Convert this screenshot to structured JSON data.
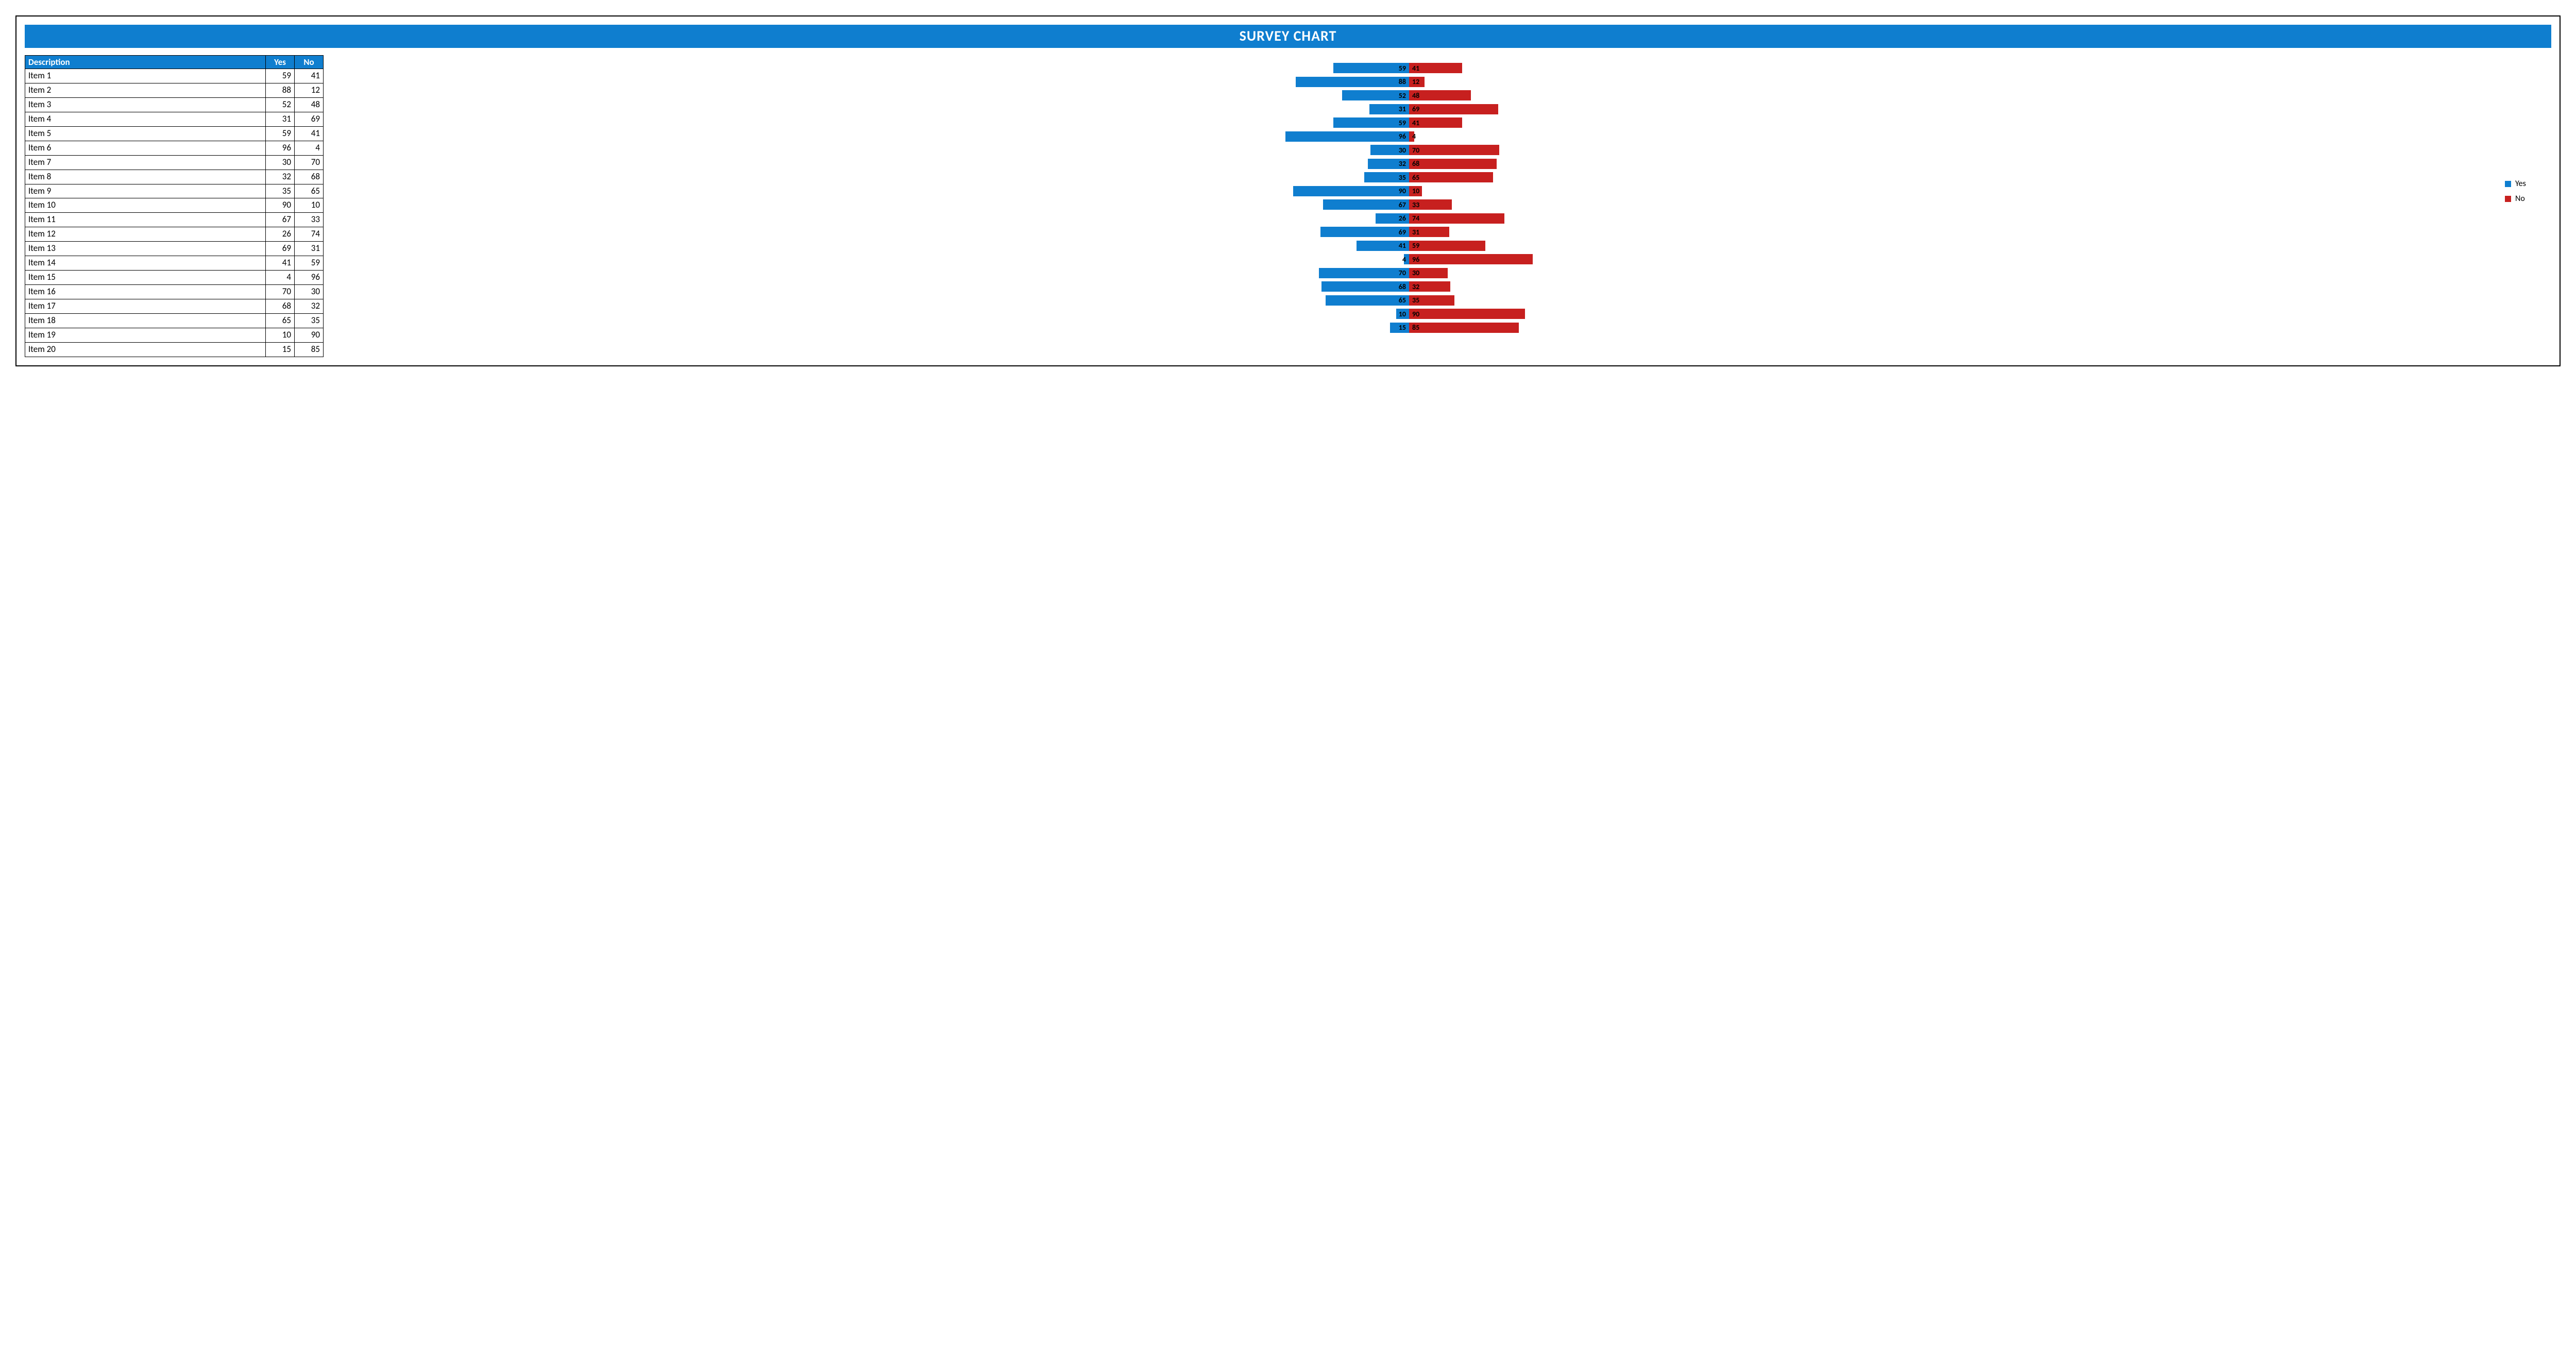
{
  "title": "SURVEY CHART",
  "columns": {
    "desc": "Description",
    "yes": "Yes",
    "no": "No"
  },
  "legend": {
    "yes": "Yes",
    "no": "No"
  },
  "items": [
    {
      "desc": "Item 1",
      "yes": 59,
      "no": 41
    },
    {
      "desc": "Item 2",
      "yes": 88,
      "no": 12
    },
    {
      "desc": "Item 3",
      "yes": 52,
      "no": 48
    },
    {
      "desc": "Item 4",
      "yes": 31,
      "no": 69
    },
    {
      "desc": "Item 5",
      "yes": 59,
      "no": 41
    },
    {
      "desc": "Item 6",
      "yes": 96,
      "no": 4
    },
    {
      "desc": "Item 7",
      "yes": 30,
      "no": 70
    },
    {
      "desc": "Item 8",
      "yes": 32,
      "no": 68
    },
    {
      "desc": "Item 9",
      "yes": 35,
      "no": 65
    },
    {
      "desc": "Item 10",
      "yes": 90,
      "no": 10
    },
    {
      "desc": "Item 11",
      "yes": 67,
      "no": 33
    },
    {
      "desc": "Item 12",
      "yes": 26,
      "no": 74
    },
    {
      "desc": "Item 13",
      "yes": 69,
      "no": 31
    },
    {
      "desc": "Item 14",
      "yes": 41,
      "no": 59
    },
    {
      "desc": "Item 15",
      "yes": 4,
      "no": 96
    },
    {
      "desc": "Item 16",
      "yes": 70,
      "no": 30
    },
    {
      "desc": "Item 17",
      "yes": 68,
      "no": 32
    },
    {
      "desc": "Item 18",
      "yes": 65,
      "no": 35
    },
    {
      "desc": "Item 19",
      "yes": 10,
      "no": 90
    },
    {
      "desc": "Item 20",
      "yes": 15,
      "no": 85
    }
  ],
  "chart_data": {
    "type": "bar",
    "title": "SURVEY CHART",
    "orientation": "horizontal-diverging",
    "categories": [
      "Item 1",
      "Item 2",
      "Item 3",
      "Item 4",
      "Item 5",
      "Item 6",
      "Item 7",
      "Item 8",
      "Item 9",
      "Item 10",
      "Item 11",
      "Item 12",
      "Item 13",
      "Item 14",
      "Item 15",
      "Item 16",
      "Item 17",
      "Item 18",
      "Item 19",
      "Item 20"
    ],
    "series": [
      {
        "name": "Yes",
        "color": "#0f7ecf",
        "values": [
          59,
          88,
          52,
          31,
          59,
          96,
          30,
          32,
          35,
          90,
          67,
          26,
          69,
          41,
          4,
          70,
          68,
          65,
          10,
          15
        ]
      },
      {
        "name": "No",
        "color": "#c7201f",
        "values": [
          41,
          12,
          48,
          69,
          41,
          4,
          70,
          68,
          65,
          10,
          33,
          74,
          31,
          59,
          96,
          30,
          32,
          35,
          90,
          85
        ]
      }
    ],
    "xlabel": "",
    "ylabel": "",
    "xlim": [
      -100,
      100
    ],
    "legend_position": "right"
  }
}
